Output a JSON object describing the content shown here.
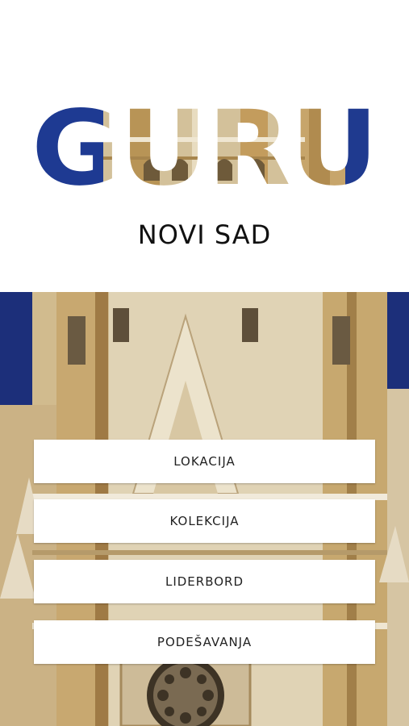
{
  "app": {
    "logo_text": "GURU",
    "city": "NOVI SAD"
  },
  "menu": {
    "items": [
      {
        "label": "LOKACIJA"
      },
      {
        "label": "KOLEKCIJA"
      },
      {
        "label": "LIDERBORD"
      },
      {
        "label": "PODEŠAVANJA"
      }
    ]
  },
  "colors": {
    "sky_blue": "#1f3a8f",
    "stone": "#cdbb93",
    "brick": "#c9a86e",
    "button_bg": "#ffffff",
    "text": "#222222"
  },
  "images": {
    "logo": "cathedral-photo-inside-logo-letters",
    "background": "cathedral-facade-photo"
  }
}
